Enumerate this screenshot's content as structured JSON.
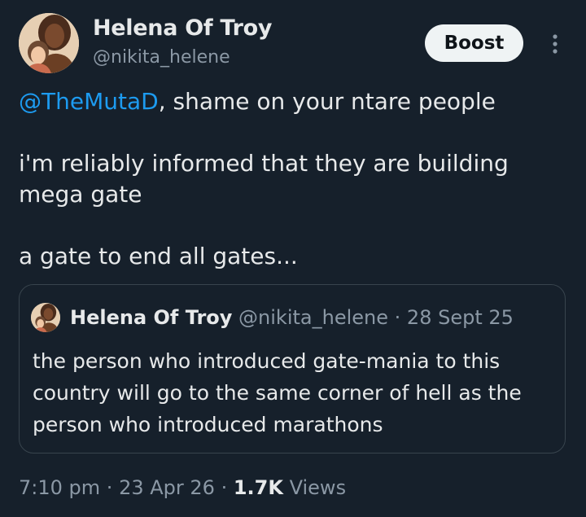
{
  "post": {
    "author_name": "Helena Of Troy",
    "author_handle": "@nikita_helene",
    "boost_label": "Boost",
    "more_icon": "more-vertical-icon",
    "mention": "@TheMutaD",
    "line1_rest": ", shame on your ntare people",
    "line2": "i'm reliably informed that they are building mega gate",
    "line3": "a gate to end all gates..."
  },
  "quoted": {
    "author_name": "Helena Of Troy",
    "author_handle": "@nikita_helene",
    "separator": "·",
    "date": "28 Sept 25",
    "text": "the person who introduced gate-mania to this country will go to the same corner of hell as the person who introduced marathons"
  },
  "footer": {
    "time": "7:10 pm",
    "separator": "·",
    "date": "23 Apr 26",
    "views_count": "1.7K",
    "views_label": "Views"
  },
  "colors": {
    "background": "#16202b",
    "text": "#e7e9ea",
    "muted": "#8b98a5",
    "link": "#1d9bf0",
    "border": "#38444d"
  }
}
